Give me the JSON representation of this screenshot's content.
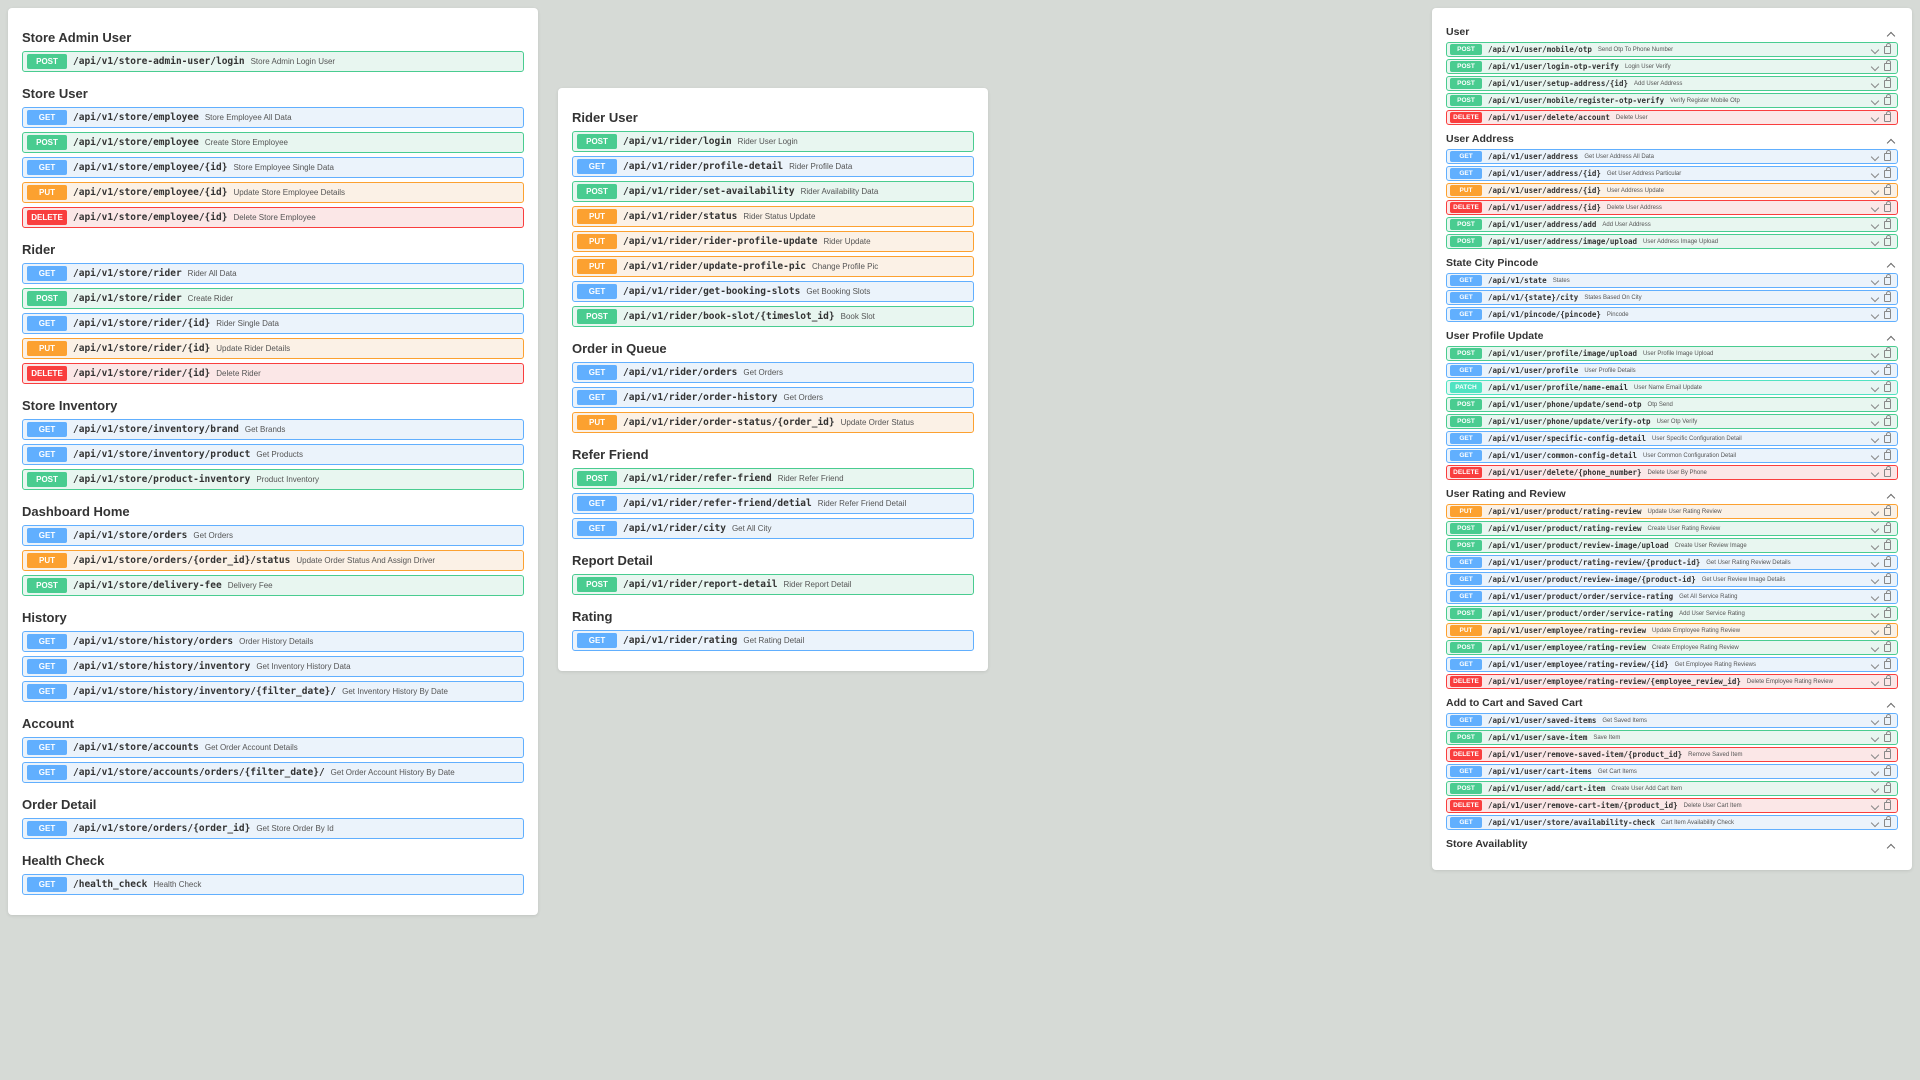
{
  "panels": [
    {
      "cls": "col1",
      "sections": [
        {
          "title": "Store Admin User",
          "eps": [
            {
              "m": "POST",
              "p": "/api/v1/store-admin-user/login",
              "d": "Store Admin Login User"
            }
          ]
        },
        {
          "title": "Store User",
          "eps": [
            {
              "m": "GET",
              "p": "/api/v1/store/employee",
              "d": "Store Employee All Data"
            },
            {
              "m": "POST",
              "p": "/api/v1/store/employee",
              "d": "Create Store Employee"
            },
            {
              "m": "GET",
              "p": "/api/v1/store/employee/{id}",
              "d": "Store Employee Single Data"
            },
            {
              "m": "PUT",
              "p": "/api/v1/store/employee/{id}",
              "d": "Update Store Employee Details"
            },
            {
              "m": "DELETE",
              "p": "/api/v1/store/employee/{id}",
              "d": "Delete Store Employee"
            }
          ]
        },
        {
          "title": "Rider",
          "eps": [
            {
              "m": "GET",
              "p": "/api/v1/store/rider",
              "d": "Rider All Data"
            },
            {
              "m": "POST",
              "p": "/api/v1/store/rider",
              "d": "Create Rider"
            },
            {
              "m": "GET",
              "p": "/api/v1/store/rider/{id}",
              "d": "Rider Single Data"
            },
            {
              "m": "PUT",
              "p": "/api/v1/store/rider/{id}",
              "d": "Update Rider Details"
            },
            {
              "m": "DELETE",
              "p": "/api/v1/store/rider/{id}",
              "d": "Delete Rider"
            }
          ]
        },
        {
          "title": "Store Inventory",
          "eps": [
            {
              "m": "GET",
              "p": "/api/v1/store/inventory/brand",
              "d": "Get Brands"
            },
            {
              "m": "GET",
              "p": "/api/v1/store/inventory/product",
              "d": "Get Products"
            },
            {
              "m": "POST",
              "p": "/api/v1/store/product-inventory",
              "d": "Product Inventory"
            }
          ]
        },
        {
          "title": "Dashboard Home",
          "eps": [
            {
              "m": "GET",
              "p": "/api/v1/store/orders",
              "d": "Get Orders"
            },
            {
              "m": "PUT",
              "p": "/api/v1/store/orders/{order_id}/status",
              "d": "Update Order Status And Assign Driver"
            },
            {
              "m": "POST",
              "p": "/api/v1/store/delivery-fee",
              "d": "Delivery Fee"
            }
          ]
        },
        {
          "title": "History",
          "eps": [
            {
              "m": "GET",
              "p": "/api/v1/store/history/orders",
              "d": "Order History Details"
            },
            {
              "m": "GET",
              "p": "/api/v1/store/history/inventory",
              "d": "Get Inventory History Data"
            },
            {
              "m": "GET",
              "p": "/api/v1/store/history/inventory/{filter_date}/",
              "d": "Get Inventory History By Date"
            }
          ]
        },
        {
          "title": "Account",
          "eps": [
            {
              "m": "GET",
              "p": "/api/v1/store/accounts",
              "d": "Get Order Account Details"
            },
            {
              "m": "GET",
              "p": "/api/v1/store/accounts/orders/{filter_date}/",
              "d": "Get Order Account History By Date"
            }
          ]
        },
        {
          "title": "Order Detail",
          "eps": [
            {
              "m": "GET",
              "p": "/api/v1/store/orders/{order_id}",
              "d": "Get Store Order By Id"
            }
          ]
        },
        {
          "title": "Health Check",
          "eps": [
            {
              "m": "GET",
              "p": "/health_check",
              "d": "Health Check"
            }
          ]
        }
      ]
    },
    {
      "cls": "col2",
      "sections": [
        {
          "title": "Rider User",
          "eps": [
            {
              "m": "POST",
              "p": "/api/v1/rider/login",
              "d": "Rider User Login"
            },
            {
              "m": "GET",
              "p": "/api/v1/rider/profile-detail",
              "d": "Rider Profile Data"
            },
            {
              "m": "POST",
              "p": "/api/v1/rider/set-availability",
              "d": "Rider Availability Data"
            },
            {
              "m": "PUT",
              "p": "/api/v1/rider/status",
              "d": "Rider Status Update"
            },
            {
              "m": "PUT",
              "p": "/api/v1/rider/rider-profile-update",
              "d": "Rider Update"
            },
            {
              "m": "PUT",
              "p": "/api/v1/rider/update-profile-pic",
              "d": "Change Profile Pic"
            },
            {
              "m": "GET",
              "p": "/api/v1/rider/get-booking-slots",
              "d": "Get Booking Slots"
            },
            {
              "m": "POST",
              "p": "/api/v1/rider/book-slot/{timeslot_id}",
              "d": "Book Slot"
            }
          ]
        },
        {
          "title": "Order in Queue",
          "eps": [
            {
              "m": "GET",
              "p": "/api/v1/rider/orders",
              "d": "Get Orders"
            },
            {
              "m": "GET",
              "p": "/api/v1/rider/order-history",
              "d": "Get Orders"
            },
            {
              "m": "PUT",
              "p": "/api/v1/rider/order-status/{order_id}",
              "d": "Update Order Status"
            }
          ]
        },
        {
          "title": "Refer Friend",
          "eps": [
            {
              "m": "POST",
              "p": "/api/v1/rider/refer-friend",
              "d": "Rider Refer Friend"
            },
            {
              "m": "GET",
              "p": "/api/v1/rider/refer-friend/detial",
              "d": "Rider Refer Friend Detail"
            },
            {
              "m": "GET",
              "p": "/api/v1/rider/city",
              "d": "Get All City"
            }
          ]
        },
        {
          "title": "Report Detail",
          "eps": [
            {
              "m": "POST",
              "p": "/api/v1/rider/report-detail",
              "d": "Rider Report Detail"
            }
          ]
        },
        {
          "title": "Rating",
          "eps": [
            {
              "m": "GET",
              "p": "/api/v1/rider/rating",
              "d": "Get Rating Detail"
            }
          ]
        }
      ]
    },
    {
      "cls": "col3",
      "sections": [
        {
          "title": "User",
          "collapsible": true,
          "eps": [
            {
              "m": "POST",
              "p": "/api/v1/user/mobile/otp",
              "d": "Send Otp To Phone Number"
            },
            {
              "m": "POST",
              "p": "/api/v1/user/login-otp-verify",
              "d": "Login User Verify"
            },
            {
              "m": "POST",
              "p": "/api/v1/user/setup-address/{id}",
              "d": "Add User Address"
            },
            {
              "m": "POST",
              "p": "/api/v1/user/mobile/register-otp-verify",
              "d": "Verify Register Mobile Otp"
            },
            {
              "m": "DELETE",
              "p": "/api/v1/user/delete/account",
              "d": "Delete User"
            }
          ]
        },
        {
          "title": "User Address",
          "collapsible": true,
          "eps": [
            {
              "m": "GET",
              "p": "/api/v1/user/address",
              "d": "Get User Address All Data"
            },
            {
              "m": "GET",
              "p": "/api/v1/user/address/{id}",
              "d": "Get User Address Particular"
            },
            {
              "m": "PUT",
              "p": "/api/v1/user/address/{id}",
              "d": "User Address Update"
            },
            {
              "m": "DELETE",
              "p": "/api/v1/user/address/{id}",
              "d": "Delete User Address"
            },
            {
              "m": "POST",
              "p": "/api/v1/user/address/add",
              "d": "Add User Address"
            },
            {
              "m": "POST",
              "p": "/api/v1/user/address/image/upload",
              "d": "User Address Image Upload"
            }
          ]
        },
        {
          "title": "State City Pincode",
          "collapsible": true,
          "eps": [
            {
              "m": "GET",
              "p": "/api/v1/state",
              "d": "States"
            },
            {
              "m": "GET",
              "p": "/api/v1/{state}/city",
              "d": "States Based On City"
            },
            {
              "m": "GET",
              "p": "/api/v1/pincode/{pincode}",
              "d": "Pincode"
            }
          ]
        },
        {
          "title": "User Profile Update",
          "collapsible": true,
          "eps": [
            {
              "m": "POST",
              "p": "/api/v1/user/profile/image/upload",
              "d": "User Profile Image Upload"
            },
            {
              "m": "GET",
              "p": "/api/v1/user/profile",
              "d": "User Profile Details"
            },
            {
              "m": "PATCH",
              "p": "/api/v1/user/profile/name-email",
              "d": "User Name Email Update"
            },
            {
              "m": "POST",
              "p": "/api/v1/user/phone/update/send-otp",
              "d": "Otp Send"
            },
            {
              "m": "POST",
              "p": "/api/v1/user/phone/update/verify-otp",
              "d": "User Otp Verify"
            },
            {
              "m": "GET",
              "p": "/api/v1/user/specific-config-detail",
              "d": "User Specific Configuration Detail"
            },
            {
              "m": "GET",
              "p": "/api/v1/user/common-config-detail",
              "d": "User Common Configuration Detail"
            },
            {
              "m": "DELETE",
              "p": "/api/v1/user/delete/{phone_number}",
              "d": "Delete User By Phone"
            }
          ]
        },
        {
          "title": "User Rating and Review",
          "collapsible": true,
          "eps": [
            {
              "m": "PUT",
              "p": "/api/v1/user/product/rating-review",
              "d": "Update User Rating Review"
            },
            {
              "m": "POST",
              "p": "/api/v1/user/product/rating-review",
              "d": "Create User Rating Review"
            },
            {
              "m": "POST",
              "p": "/api/v1/user/product/review-image/upload",
              "d": "Create User Review Image"
            },
            {
              "m": "GET",
              "p": "/api/v1/user/product/rating-review/{product-id}",
              "d": "Get User Rating Review Details"
            },
            {
              "m": "GET",
              "p": "/api/v1/user/product/review-image/{product-id}",
              "d": "Get User Review Image Details"
            },
            {
              "m": "GET",
              "p": "/api/v1/user/product/order/service-rating",
              "d": "Get All Service Rating"
            },
            {
              "m": "POST",
              "p": "/api/v1/user/product/order/service-rating",
              "d": "Add User Service Rating"
            },
            {
              "m": "PUT",
              "p": "/api/v1/user/employee/rating-review",
              "d": "Update Employee Rating Review"
            },
            {
              "m": "POST",
              "p": "/api/v1/user/employee/rating-review",
              "d": "Create Employee Rating Review"
            },
            {
              "m": "GET",
              "p": "/api/v1/user/employee/rating-review/{id}",
              "d": "Get Employee Rating Reviews"
            },
            {
              "m": "DELETE",
              "p": "/api/v1/user/employee/rating-review/{employee_review_id}",
              "d": "Delete Employee Rating Review"
            }
          ]
        },
        {
          "title": "Add to Cart and Saved Cart",
          "collapsible": true,
          "eps": [
            {
              "m": "GET",
              "p": "/api/v1/user/saved-items",
              "d": "Get Saved Items"
            },
            {
              "m": "POST",
              "p": "/api/v1/user/save-item",
              "d": "Save Item"
            },
            {
              "m": "DELETE",
              "p": "/api/v1/user/remove-saved-item/{product_id}",
              "d": "Remove Saved Item"
            },
            {
              "m": "GET",
              "p": "/api/v1/user/cart-items",
              "d": "Get Cart Items"
            },
            {
              "m": "POST",
              "p": "/api/v1/user/add/cart-item",
              "d": "Create User Add Cart Item"
            },
            {
              "m": "DELETE",
              "p": "/api/v1/user/remove-cart-item/{product_id}",
              "d": "Delete User Cart Item"
            },
            {
              "m": "GET",
              "p": "/api/v1/user/store/availability-check",
              "d": "Cart Item Availability Check"
            }
          ]
        },
        {
          "title": "Store Availablity",
          "collapsible": true,
          "eps": []
        }
      ]
    }
  ]
}
